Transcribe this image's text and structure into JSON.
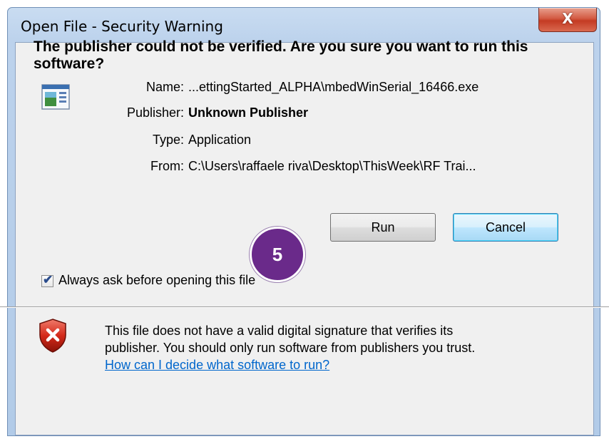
{
  "window": {
    "title": "Open File - Security Warning",
    "close_label": "X"
  },
  "warning": {
    "headline": "The publisher could not be verified.  Are you sure you want to run this software?"
  },
  "details": [
    {
      "label": "Name:",
      "value": "...ettingStarted_ALPHA\\mbedWinSerial_16466.exe",
      "bold": false
    },
    {
      "label": "Publisher:",
      "value": "Unknown Publisher",
      "bold": true
    },
    {
      "label": "Type:",
      "value": "Application",
      "bold": false
    },
    {
      "label": "From:",
      "value": "C:\\Users\\raffaele riva\\Desktop\\ThisWeek\\RF Trai...",
      "bold": false
    }
  ],
  "buttons": {
    "run_label": "Run",
    "cancel_label": "Cancel"
  },
  "step_badge": "5",
  "checkbox": {
    "label": "Always ask before opening this file",
    "checked": true
  },
  "footer": {
    "text_line1": "This file does not have a valid digital signature that verifies its",
    "text_line2": "publisher.  You should only run software from publishers you trust.",
    "link_text": "How can I decide what software to run?"
  },
  "icons": {
    "app": "application-icon",
    "shield": "security-shield-icon"
  },
  "colors": {
    "badge": "#6a2a8a",
    "link": "#0066cc",
    "close": "#c43b23"
  }
}
